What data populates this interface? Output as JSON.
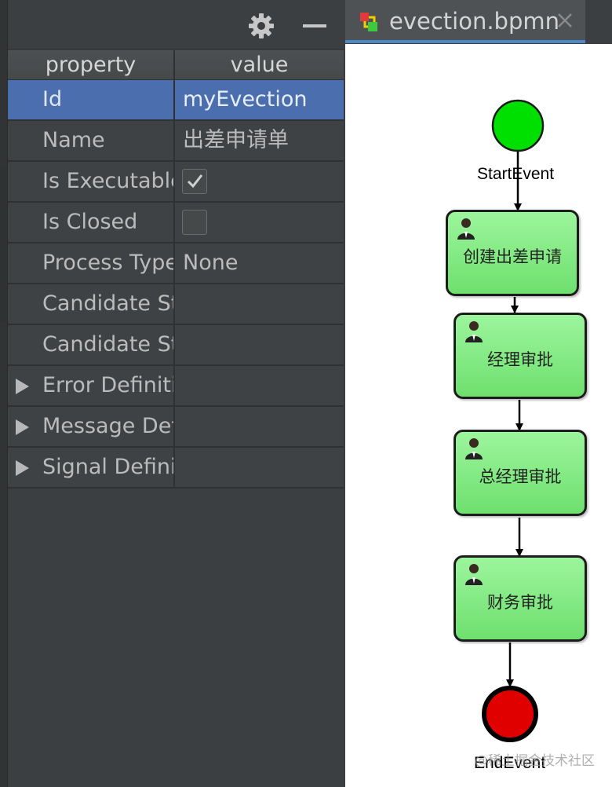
{
  "properties_panel": {
    "header": {
      "property": "property",
      "value": "value"
    },
    "rows": [
      {
        "name": "Id",
        "value": "myEvection"
      },
      {
        "name": "Name",
        "value": "出差申请单"
      },
      {
        "name": "Is Executable",
        "checked": true
      },
      {
        "name": "Is Closed",
        "checked": false
      },
      {
        "name": "Process Type",
        "value": "None"
      },
      {
        "name": "Candidate Starter Users",
        "value": ""
      },
      {
        "name": "Candidate Starter Groups",
        "value": ""
      },
      {
        "name": "Error Definitions",
        "value": ""
      },
      {
        "name": "Message Definitions",
        "value": ""
      },
      {
        "name": "Signal Definitions",
        "value": ""
      }
    ]
  },
  "editor": {
    "tab_title": "evection.bpmn",
    "diagram": {
      "start_event": {
        "label": "StartEvent",
        "color": "#00e000"
      },
      "tasks": [
        {
          "label": "创建出差申请",
          "icon": "user-task-icon"
        },
        {
          "label": "经理审批",
          "icon": "user-task-icon"
        },
        {
          "label": "总经理审批",
          "icon": "user-task-icon"
        },
        {
          "label": "财务审批",
          "icon": "user-task-icon"
        }
      ],
      "end_event": {
        "label": "EndEvent",
        "color": "#e00000"
      }
    },
    "watermark": "@稀土掘金技术社区"
  },
  "colors": {
    "selection": "#4b6eaf",
    "panel_bg": "#3c3f41",
    "task_fill": "#8ef08e"
  }
}
